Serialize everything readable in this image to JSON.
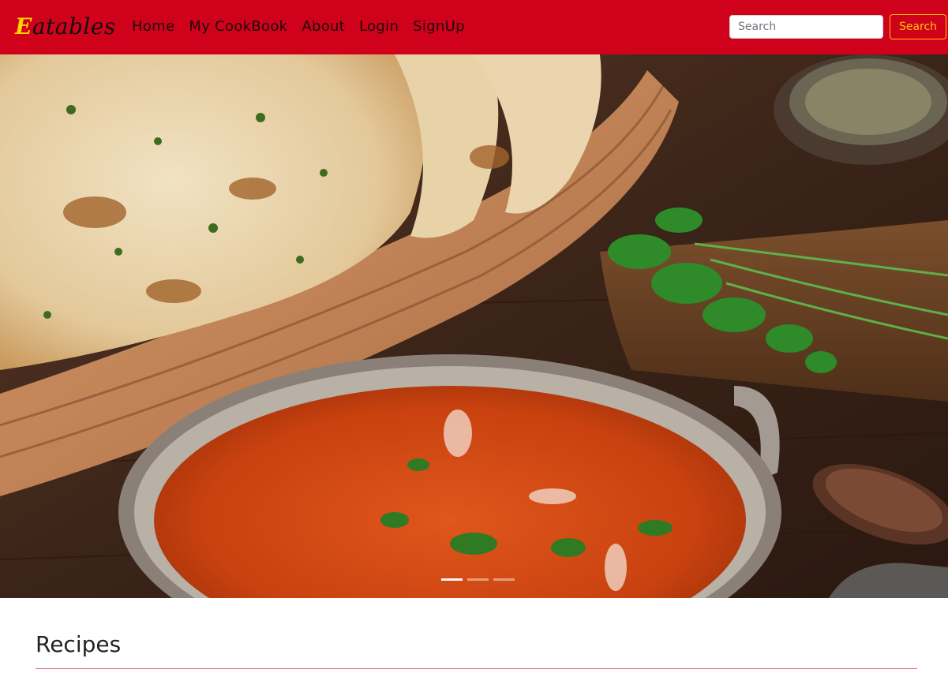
{
  "navbar": {
    "brand_first": "E",
    "brand_rest": "atables",
    "links": [
      "Home",
      "My CookBook",
      "About",
      "Login",
      "SignUp"
    ],
    "search_placeholder": "Search",
    "search_button": "Search",
    "colors": {
      "background": "#d0021b",
      "brand_accent": "#ffd400",
      "button_outline": "#ffc107"
    }
  },
  "hero": {
    "image": "food-photo-naan-basket-and-butter-chicken-karahi",
    "slides_total": 3,
    "active_slide": 1
  },
  "section": {
    "title": "Recipes"
  }
}
